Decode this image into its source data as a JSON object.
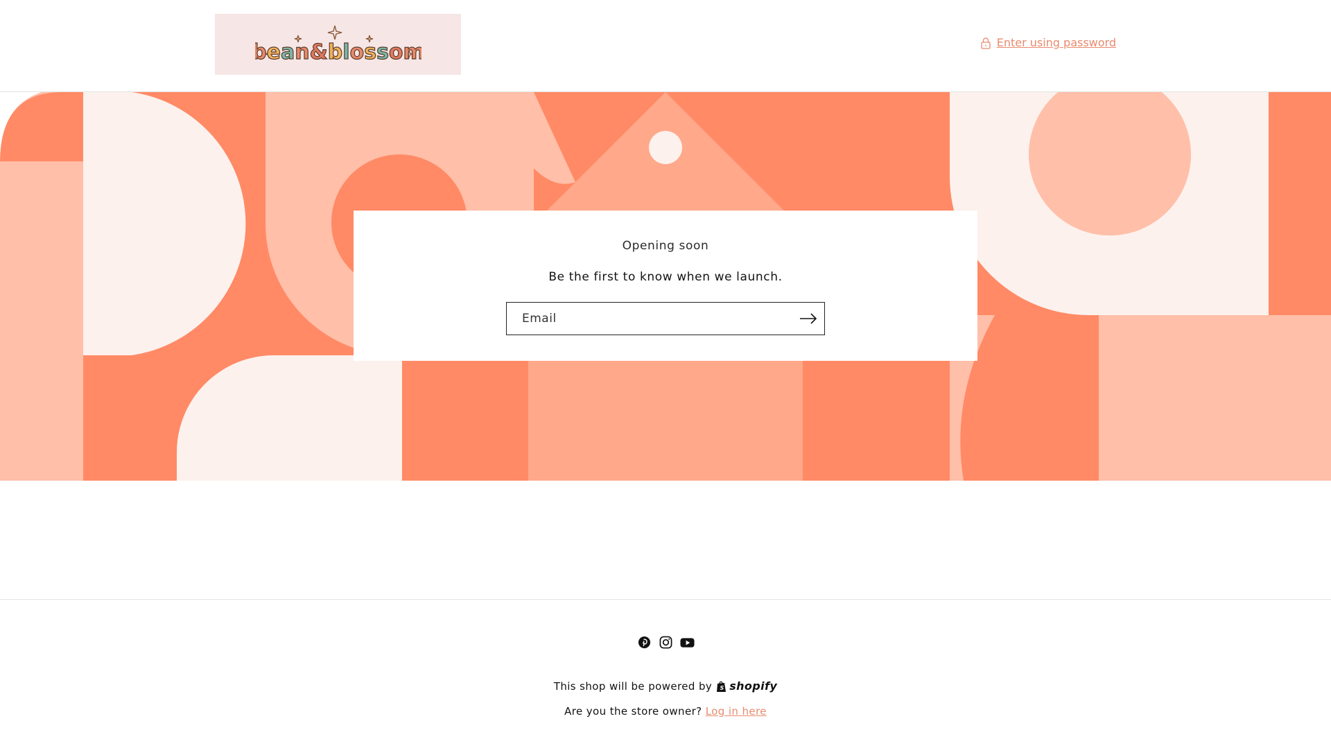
{
  "header": {
    "logo_text": "bean&blossom",
    "password_link": "Enter using password"
  },
  "newsletter": {
    "title": "Opening soon",
    "subtitle": "Be the first to know when we launch.",
    "email_placeholder": "Email"
  },
  "footer": {
    "socials": [
      "pinterest-icon",
      "instagram-icon",
      "youtube-icon"
    ],
    "powered_by": "This shop will be powered by",
    "powered_brand": "shopify",
    "owner_question": "Are you the store owner?",
    "login_link": "Log in here"
  },
  "colors": {
    "accent": "#e88a6d",
    "coral": "#ff8a65",
    "peach": "#ffbfa9",
    "salmon": "#ffa88a",
    "cream": "#fdf1ed"
  }
}
